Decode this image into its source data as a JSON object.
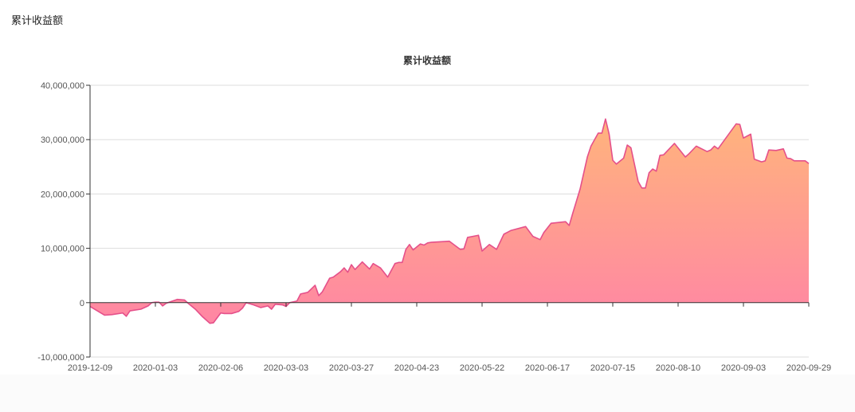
{
  "page": {
    "title": "累计收益额"
  },
  "chart_data": {
    "type": "area",
    "title": "累计收益额",
    "xlabel": "",
    "ylabel": "",
    "ylim": [
      -10000000,
      40000000
    ],
    "yticks": [
      -10000000,
      0,
      10000000,
      20000000,
      30000000,
      40000000
    ],
    "ytick_labels": [
      "-10,000,000",
      "0",
      "10,000,000",
      "20,000,000",
      "30,000,000",
      "40,000,000"
    ],
    "xlim": [
      0,
      198
    ],
    "xticks": [
      0,
      18,
      36,
      54,
      72,
      90,
      108,
      126,
      144,
      162,
      180,
      198
    ],
    "xtick_labels": [
      "2019-12-09",
      "2020-01-03",
      "2020-02-06",
      "2020-03-03",
      "2020-03-27",
      "2020-04-23",
      "2020-05-22",
      "2020-06-17",
      "2020-07-15",
      "2020-08-10",
      "2020-09-03",
      "2020-09-29"
    ],
    "grid": true,
    "colors": {
      "line": "#e5508a",
      "fill_top": "#ffb47c",
      "fill_bottom": "#ff86a4"
    },
    "series": [
      {
        "name": "累计收益额",
        "unit": "millions",
        "points": [
          [
            0,
            -0.7
          ],
          [
            4,
            -2.3
          ],
          [
            6,
            -2.2
          ],
          [
            9,
            -1.9
          ],
          [
            10,
            -2.5
          ],
          [
            11,
            -1.5
          ],
          [
            14,
            -1.2
          ],
          [
            16,
            -0.6
          ],
          [
            17,
            0
          ],
          [
            18,
            0.1
          ],
          [
            19,
            0.1
          ],
          [
            20,
            -0.6
          ],
          [
            21,
            -0.1
          ],
          [
            24,
            0.6
          ],
          [
            26,
            0.5
          ],
          [
            27,
            -0.1
          ],
          [
            29,
            -1.2
          ],
          [
            31,
            -2.6
          ],
          [
            33,
            -3.8
          ],
          [
            34,
            -3.7
          ],
          [
            36,
            -1.9
          ],
          [
            37,
            -2.0
          ],
          [
            39,
            -2.0
          ],
          [
            41,
            -1.6
          ],
          [
            42,
            -1.0
          ],
          [
            43,
            0
          ],
          [
            45,
            -0.4
          ],
          [
            47,
            -0.9
          ],
          [
            49,
            -0.6
          ],
          [
            50,
            -1.2
          ],
          [
            51,
            -0.3
          ],
          [
            53,
            -0.4
          ],
          [
            54,
            -0.7
          ],
          [
            55,
            0
          ],
          [
            57,
            0.3
          ],
          [
            58,
            1.6
          ],
          [
            60,
            1.9
          ],
          [
            62,
            3.2
          ],
          [
            63,
            1.3
          ],
          [
            64,
            2.0
          ],
          [
            66,
            4.5
          ],
          [
            67,
            4.7
          ],
          [
            69,
            5.7
          ],
          [
            70,
            6.4
          ],
          [
            71,
            5.6
          ],
          [
            72,
            7.0
          ],
          [
            73,
            6.1
          ],
          [
            75,
            7.5
          ],
          [
            77,
            6.2
          ],
          [
            78,
            7.2
          ],
          [
            80,
            6.4
          ],
          [
            82,
            4.7
          ],
          [
            84,
            7.2
          ],
          [
            85,
            7.4
          ],
          [
            86,
            7.4
          ],
          [
            87,
            9.8
          ],
          [
            88,
            10.7
          ],
          [
            89,
            9.7
          ],
          [
            91,
            10.8
          ],
          [
            92,
            10.6
          ],
          [
            93,
            11
          ],
          [
            94,
            11.1
          ],
          [
            99,
            11.3
          ],
          [
            102,
            9.8
          ],
          [
            103,
            9.9
          ],
          [
            104,
            12
          ],
          [
            107,
            12.4
          ],
          [
            108,
            9.5
          ],
          [
            110,
            10.7
          ],
          [
            112,
            9.8
          ],
          [
            114,
            12.6
          ],
          [
            116,
            13.3
          ],
          [
            120,
            14
          ],
          [
            122,
            12.2
          ],
          [
            124,
            11.6
          ],
          [
            125,
            12.9
          ],
          [
            127,
            14.6
          ],
          [
            131,
            14.9
          ],
          [
            132,
            14.2
          ],
          [
            133,
            16.5
          ],
          [
            135,
            20.9
          ],
          [
            137,
            26.8
          ],
          [
            138,
            28.8
          ],
          [
            140,
            31.2
          ],
          [
            141,
            31.2
          ],
          [
            142,
            33.8
          ],
          [
            143,
            31
          ],
          [
            144,
            26.2
          ],
          [
            145,
            25.5
          ],
          [
            147,
            26.6
          ],
          [
            148,
            29
          ],
          [
            149,
            28.5
          ],
          [
            151,
            22.3
          ],
          [
            152,
            21.1
          ],
          [
            153,
            21.1
          ],
          [
            154,
            23.9
          ],
          [
            155,
            24.6
          ],
          [
            156,
            24.2
          ],
          [
            157,
            27.1
          ],
          [
            158,
            27.2
          ],
          [
            161,
            29.3
          ],
          [
            164,
            26.8
          ],
          [
            165,
            27.4
          ],
          [
            167,
            28.8
          ],
          [
            170,
            27.8
          ],
          [
            171,
            28.1
          ],
          [
            172,
            28.8
          ],
          [
            173,
            28.3
          ],
          [
            178,
            32.9
          ],
          [
            179,
            32.8
          ],
          [
            180,
            30.3
          ],
          [
            182,
            31
          ],
          [
            183,
            26.4
          ],
          [
            185,
            25.9
          ],
          [
            186,
            26.1
          ],
          [
            187,
            28.1
          ],
          [
            189,
            28
          ],
          [
            191,
            28.3
          ],
          [
            192,
            26.6
          ],
          [
            193,
            26.5
          ],
          [
            194,
            26.1
          ],
          [
            197,
            26.1
          ],
          [
            198,
            25.6
          ]
        ]
      }
    ]
  }
}
